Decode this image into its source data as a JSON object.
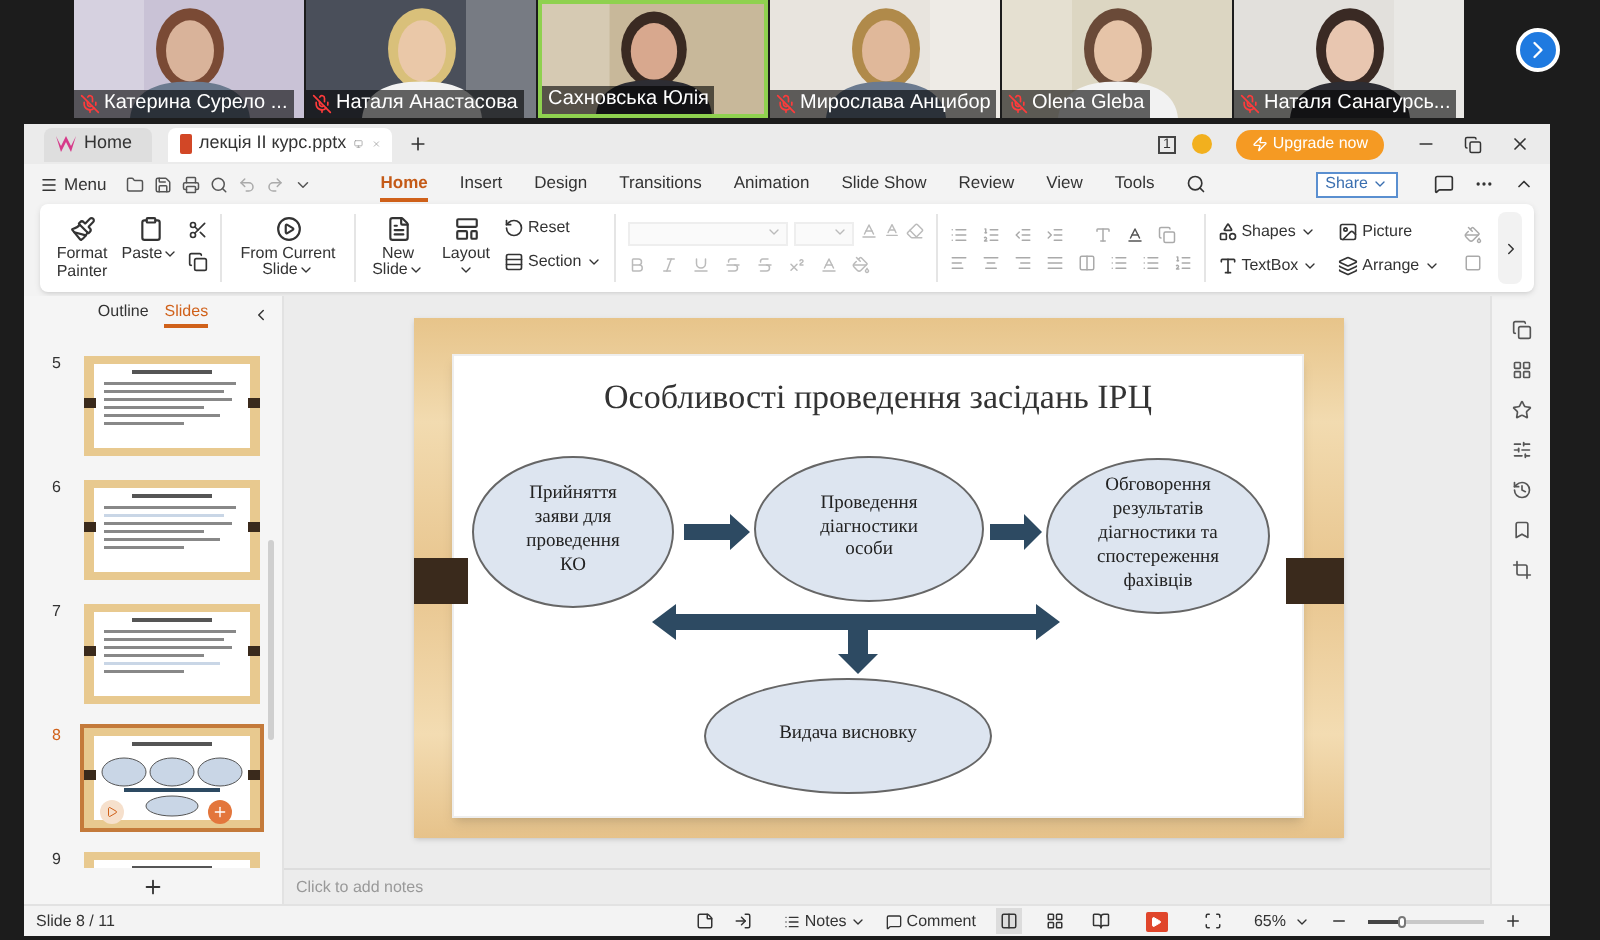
{
  "participants": [
    {
      "name": "Катерина Сурело ...",
      "muted": true,
      "speaking": false
    },
    {
      "name": "Наталя Анастасова",
      "muted": true,
      "speaking": false
    },
    {
      "name": "Сахновська Юлія",
      "muted": false,
      "speaking": true
    },
    {
      "name": "Мирослава Анцибор",
      "muted": true,
      "speaking": false
    },
    {
      "name": "Olena Gleba",
      "muted": true,
      "speaking": false
    },
    {
      "name": "Наталя Санагурсь...",
      "muted": true,
      "speaking": false
    }
  ],
  "app": {
    "tabs": [
      {
        "label": "Home",
        "kind": "home",
        "selected": false
      },
      {
        "label": "лекція ІІ курс.pptx",
        "kind": "document",
        "selected": true
      }
    ],
    "account_badge": "1",
    "upgrade": "Upgrade now",
    "menu": "Menu",
    "ribbon_tabs": [
      {
        "label": "Home",
        "selected": true
      },
      {
        "label": "Insert",
        "selected": false
      },
      {
        "label": "Design",
        "selected": false
      },
      {
        "label": "Transitions",
        "selected": false
      },
      {
        "label": "Animation",
        "selected": false
      },
      {
        "label": "Slide Show",
        "selected": false
      },
      {
        "label": "Review",
        "selected": false
      },
      {
        "label": "View",
        "selected": false
      },
      {
        "label": "Tools",
        "selected": false
      }
    ],
    "share": "Share",
    "ribbon": {
      "clipboard": [
        {
          "label": "Format Painter",
          "dropdown": false
        },
        {
          "label": "Paste",
          "dropdown": true
        }
      ],
      "slideshow": [
        {
          "label": "From Current Slide",
          "dropdown": true
        }
      ],
      "slides": [
        {
          "label": "New Slide",
          "dropdown": true
        },
        {
          "label": "Layout",
          "dropdown": true
        }
      ],
      "slides_small": [
        {
          "label": "Reset",
          "dropdown": false
        },
        {
          "label": "Section",
          "dropdown": true
        }
      ],
      "insert": [
        {
          "label": "Shapes",
          "dropdown": true
        },
        {
          "label": "TextBox",
          "dropdown": true
        },
        {
          "label": "Picture",
          "dropdown": false
        },
        {
          "label": "Arrange",
          "dropdown": true
        }
      ]
    },
    "panel_tabs": [
      {
        "label": "Outline",
        "selected": false
      },
      {
        "label": "Slides",
        "selected": true
      }
    ],
    "slides": [
      {
        "number": "5",
        "selected": false
      },
      {
        "number": "6",
        "selected": false
      },
      {
        "number": "7",
        "selected": false
      },
      {
        "number": "8",
        "selected": true
      },
      {
        "number": "9",
        "selected": false
      }
    ],
    "slide": {
      "title": "Особливості проведення засідань ІРЦ",
      "boxes": [
        {
          "text": "Прийняття\nзаяви для\nпроведення\nКО"
        },
        {
          "text": "Проведення\nдіагностики\nособи"
        },
        {
          "text": "Обговорення\nрезультатів\nдіагностики та\nспостереження\nфахівців"
        },
        {
          "text": "Видача висновку"
        }
      ]
    },
    "notes_placeholder": "Click to add notes",
    "status": {
      "slide": "Slide 8 / 11",
      "notes": "Notes",
      "comment": "Comment",
      "views": [
        {
          "selected": true
        },
        {
          "selected": false
        },
        {
          "selected": false
        }
      ],
      "zoom": "65%",
      "zoom_slider": {
        "level": 0.3
      }
    }
  }
}
